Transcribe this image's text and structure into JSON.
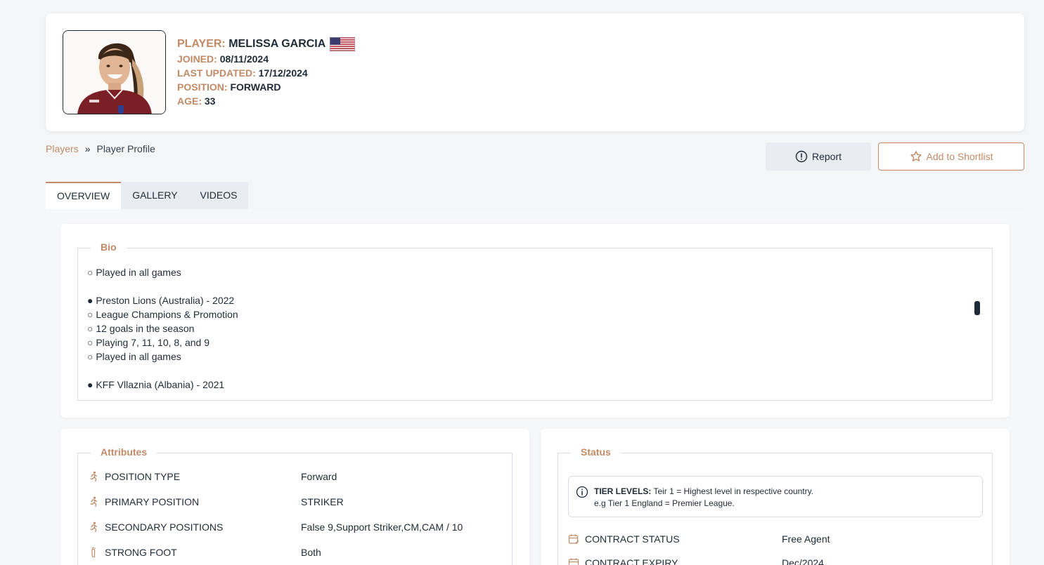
{
  "player": {
    "name_label": "PLAYER:",
    "name": "MELISSA GARCIA",
    "joined_label": "JOINED:",
    "joined": "08/11/2024",
    "updated_label": "LAST UPDATED:",
    "updated": "17/12/2024",
    "position_label": "POSITION:",
    "position": "FORWARD",
    "age_label": "AGE:",
    "age": "33",
    "flag_icon": "us-flag-icon"
  },
  "breadcrumb": {
    "link": "Players",
    "separator": "»",
    "current": "Player Profile"
  },
  "actions": {
    "report_label": "Report",
    "shortlist_label": "Add to Shortlist"
  },
  "tabs": [
    {
      "label": "OVERVIEW",
      "active": true
    },
    {
      "label": "GALLERY",
      "active": false
    },
    {
      "label": "VIDEOS",
      "active": false
    }
  ],
  "bio": {
    "title": "Bio",
    "lines": [
      "○ Played in all games",
      "",
      "● Preston Lions (Australia) - 2022",
      "○ League Champions & Promotion",
      "○ 12 goals in the season",
      "○ Playing 7, 11, 10, 8, and 9",
      "○ Played in all games",
      "",
      "● KFF Vllaznia (Albania) - 2021"
    ]
  },
  "attributes": {
    "title": "Attributes",
    "rows": [
      {
        "label": "POSITION TYPE",
        "value": "Forward",
        "icon": "runner-icon"
      },
      {
        "label": "PRIMARY POSITION",
        "value": "STRIKER",
        "icon": "runner-icon"
      },
      {
        "label": "SECONDARY POSITIONS",
        "value": "False 9,Support Striker,CM,CAM / 10",
        "icon": "runner-icon"
      },
      {
        "label": "STRONG FOOT",
        "value": "Both",
        "icon": "footprint-icon"
      }
    ]
  },
  "status": {
    "title": "Status",
    "info_label": "TIER LEVELS:",
    "info_text": " Teir 1 = Highest level in respective country.",
    "info_text2": "e.g Tier 1 England = Premier League.",
    "rows": [
      {
        "label": "CONTRACT STATUS",
        "value": "Free Agent",
        "icon": "calendar-edit-icon"
      },
      {
        "label": "CONTRACT EXPIRY",
        "value": "Dec/2024",
        "icon": "calendar-icon"
      }
    ]
  },
  "colors": {
    "accent": "#c28a66",
    "text": "#1f2a37",
    "background": "#f3f5f7"
  }
}
